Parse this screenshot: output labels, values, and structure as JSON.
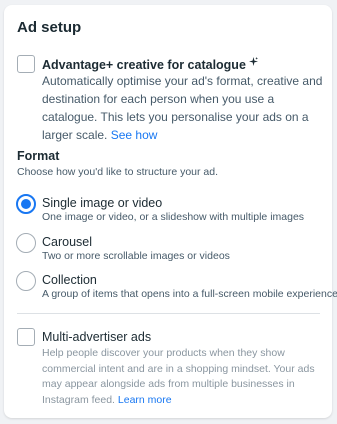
{
  "title": "Ad setup",
  "advantage": {
    "label": "Advantage+ creative for catalogue",
    "description": "Automatically optimise your ad's format, creative and destination for each person when you use a catalogue. This lets you personalise your ads on a larger scale.",
    "link": "See how",
    "icon": "sparkle-icon"
  },
  "format": {
    "heading": "Format",
    "subheading": "Choose how you'd like to structure your ad.",
    "options": [
      {
        "label": "Single image or video",
        "description": "One image or video, or a slideshow with multiple images",
        "selected": true
      },
      {
        "label": "Carousel",
        "description": "Two or more scrollable images or videos",
        "selected": false
      },
      {
        "label": "Collection",
        "description": "A group of items that opens into a full-screen mobile experience",
        "selected": false
      }
    ]
  },
  "multi_advertiser": {
    "label": "Multi-advertiser ads",
    "description": "Help people discover your products when they show commercial intent and are in a shopping mindset. Your ads may appear alongside ads from multiple businesses in Instagram feed.",
    "link": "Learn more"
  },
  "colors": {
    "accent": "#1877f2",
    "text": "#1c2b33",
    "muted": "#8a96a0"
  }
}
